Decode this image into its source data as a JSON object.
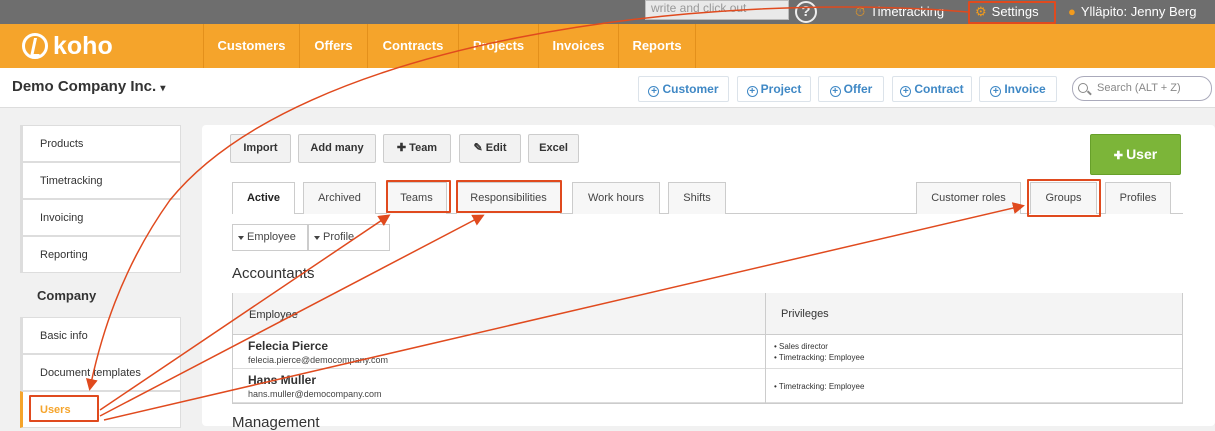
{
  "topbar": {
    "write_placeholder": "write and click out",
    "timetracking": "Timetracking",
    "settings": "Settings",
    "user": "Ylläpito: Jenny Berg"
  },
  "brand": {
    "name": "koho",
    "accent": "#f5a42b",
    "highlight": "#e04a1e"
  },
  "nav": [
    "Customers",
    "Offers",
    "Contracts",
    "Projects",
    "Invoices",
    "Reports"
  ],
  "company": "Demo Company Inc.",
  "quick": [
    "Customer",
    "Project",
    "Offer",
    "Contract",
    "Invoice"
  ],
  "search": {
    "placeholder": "Search (ALT + Z)"
  },
  "sidebar": {
    "top": [
      "Products",
      "Timetracking",
      "Invoicing",
      "Reporting"
    ],
    "company_heading": "Company",
    "company_items": [
      "Basic info",
      "Document templates",
      "Users"
    ]
  },
  "toolbar": [
    "Import",
    "Add many",
    "Team",
    "Edit",
    "Excel"
  ],
  "user_button": "User",
  "tabs_left": [
    "Active",
    "Archived",
    "Teams",
    "Responsibilities",
    "Work hours",
    "Shifts"
  ],
  "tabs_right": [
    "Customer roles",
    "Groups",
    "Profiles"
  ],
  "filters": [
    "Employee",
    "Profile"
  ],
  "sections": {
    "accountants": "Accountants",
    "management": "Management"
  },
  "table": {
    "headers": [
      "Employee",
      "Privileges"
    ],
    "rows": [
      {
        "name": "Felecia Pierce",
        "email": "felecia.pierce@democompany.com",
        "privileges": [
          "Sales director",
          "Timetracking: Employee"
        ]
      },
      {
        "name": "Hans Muller",
        "email": "hans.muller@democompany.com",
        "privileges": [
          "Timetracking: Employee"
        ]
      }
    ]
  }
}
